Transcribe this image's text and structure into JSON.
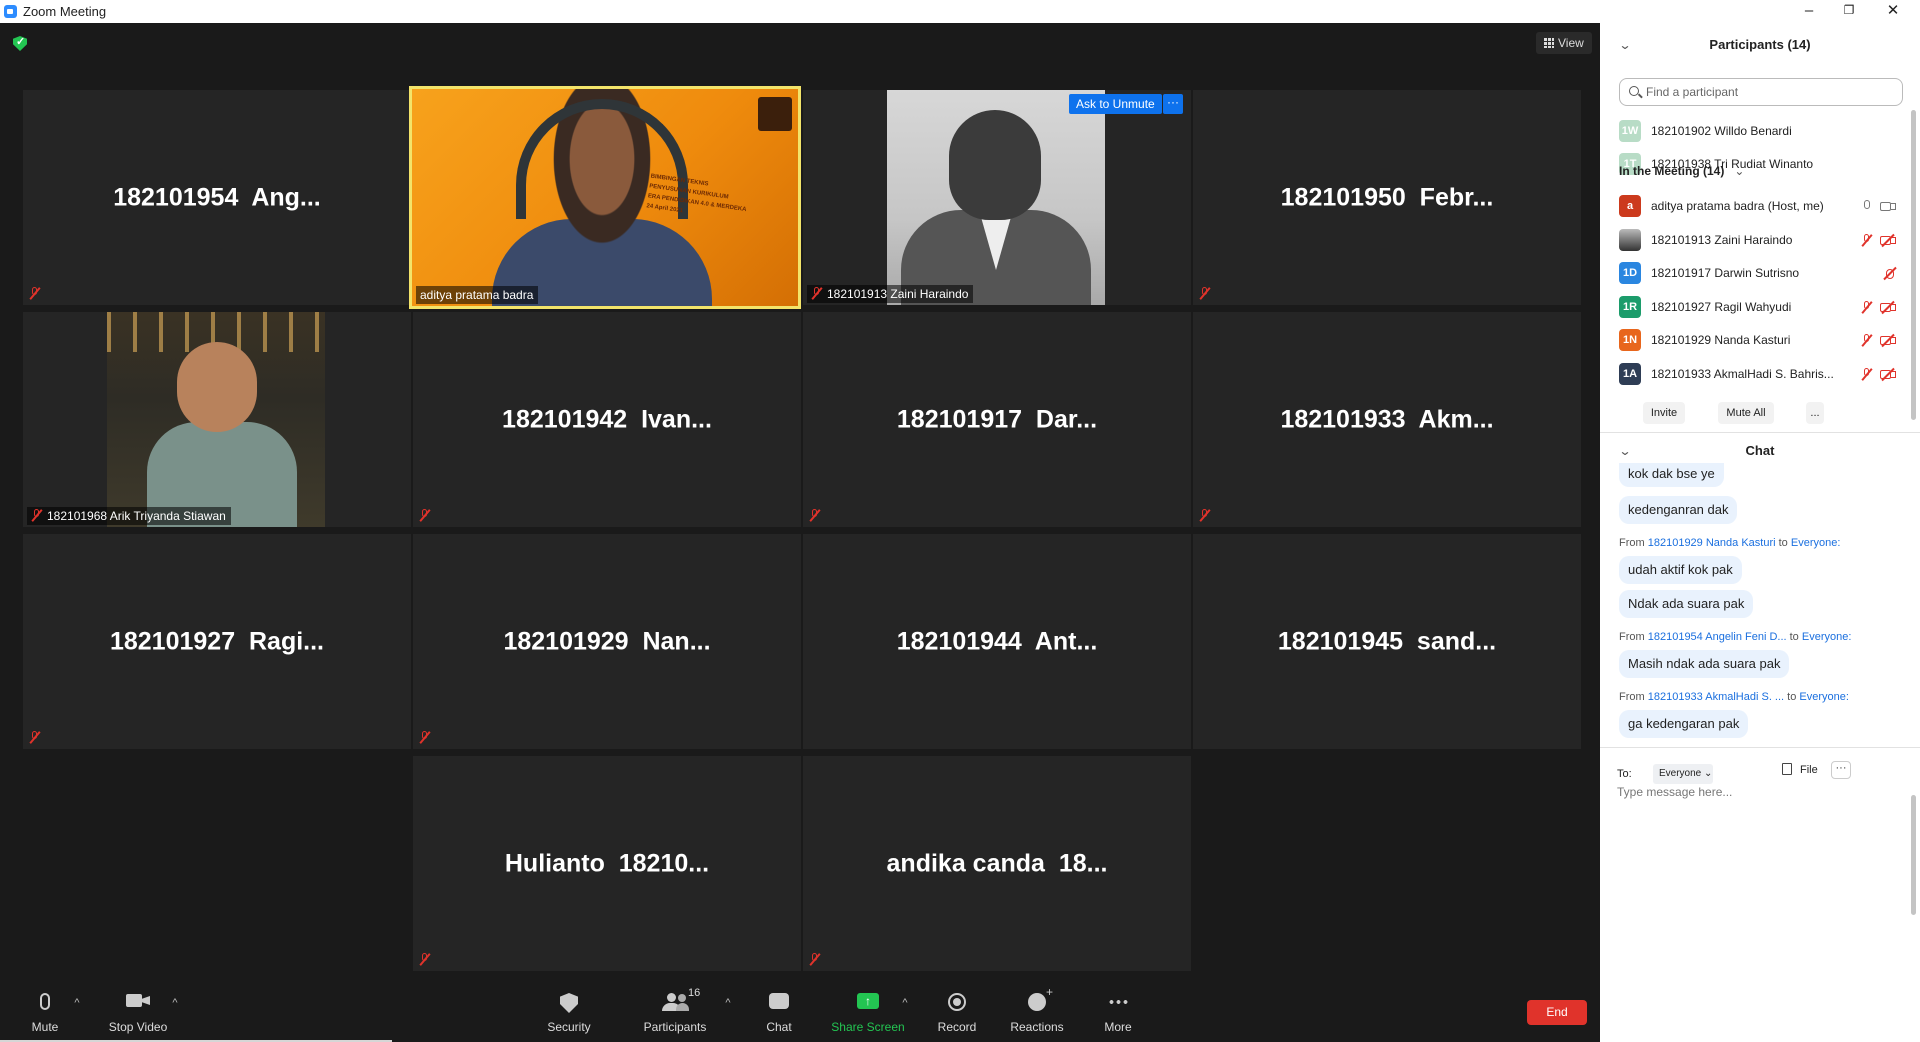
{
  "window": {
    "title": "Zoom Meeting",
    "minimize": "–",
    "restore": "❐",
    "close": "✕"
  },
  "view_button": {
    "label": "View"
  },
  "tiles": {
    "t1": {
      "name": "182101954  Ang..."
    },
    "t2": {
      "caption": "aditya pratama badra"
    },
    "t3": {
      "caption": "182101913 Zaini Haraindo"
    },
    "t4": {
      "name": "182101950  Febr..."
    },
    "t5": {
      "caption": "182101968 Arik Triyanda Stiawan"
    },
    "t6": {
      "name": "182101942  Ivan..."
    },
    "t7": {
      "name": "182101917  Dar..."
    },
    "t8": {
      "name": "182101933  Akm..."
    },
    "t9": {
      "name": "182101927  Ragi..."
    },
    "t10": {
      "name": "182101929  Nan..."
    },
    "t11": {
      "name": "182101944  Ant..."
    },
    "t12": {
      "name": "182101945  sand..."
    },
    "t13": {
      "name": "Hulianto  18210..."
    },
    "t14": {
      "name": "andika canda  18..."
    }
  },
  "ask_to_unmute": {
    "label": "Ask to Unmute",
    "more": "···"
  },
  "banner_text": "BIMBINGAN TEKNIS\nPENYUSUNAN KURIKULUM\nERA PENDIDIKAN 4.0 & MERDEKA\n24 April 2021",
  "toolbar": {
    "mute": "Mute",
    "stop_video": "Stop Video",
    "security": "Security",
    "participants": "Participants",
    "participants_count": "16",
    "chat": "Chat",
    "share_screen": "Share Screen",
    "record": "Record",
    "reactions": "Reactions",
    "more": "More",
    "end": "End",
    "caret": "^"
  },
  "colors": {
    "accent_blue": "#0e72ed",
    "end_red": "#e0332b",
    "share_green": "#23c552",
    "speaker_border": "#f3e46a"
  },
  "participants_panel": {
    "title": "Participants (14)",
    "search_placeholder": "Find a participant",
    "waiting": [
      {
        "initials": "1W",
        "name": "182101902 Willdo Benardi"
      },
      {
        "initials": "1T",
        "name": "182101938 Tri Rudiat Winanto"
      }
    ],
    "in_meeting_header": "In the Meeting (14)",
    "in_meeting": [
      {
        "initials": "a",
        "name": "aditya pratama badra (Host, me)"
      },
      {
        "initials": "",
        "name": "182101913 Zaini Haraindo"
      },
      {
        "initials": "1D",
        "name": "182101917 Darwin Sutrisno"
      },
      {
        "initials": "1R",
        "name": "182101927 Ragil Wahyudi"
      },
      {
        "initials": "1N",
        "name": "182101929 Nanda Kasturi"
      },
      {
        "initials": "1A",
        "name": "182101933 AkmalHadi S. Bahris..."
      }
    ],
    "invite": "Invite",
    "mute_all": "Mute All",
    "more": "..."
  },
  "chat_panel": {
    "title": "Chat",
    "messages": [
      {
        "text": "kok dak bse ye"
      },
      {
        "text": "kedenganran dak"
      },
      {
        "from_prefix": "From",
        "from_name": "182101929 Nanda Kasturi",
        "to_word": "to",
        "to_name": "Everyone:"
      },
      {
        "text": "udah aktif kok pak"
      },
      {
        "text": "Ndak ada suara pak"
      },
      {
        "from_prefix": "From",
        "from_name": "182101954 Angelin Feni D...",
        "to_word": "to",
        "to_name": "Everyone:"
      },
      {
        "text": "Masih ndak ada suara pak"
      },
      {
        "from_prefix": "From",
        "from_name": "182101933 AkmalHadi S. ...",
        "to_word": "to",
        "to_name": "Everyone:"
      },
      {
        "text": "ga kedengaran pak"
      }
    ],
    "to_label": "To:",
    "to_value": "Everyone ⌄",
    "file": "File",
    "more": "···",
    "input_placeholder": "Type message here..."
  },
  "chevron": "⌄"
}
